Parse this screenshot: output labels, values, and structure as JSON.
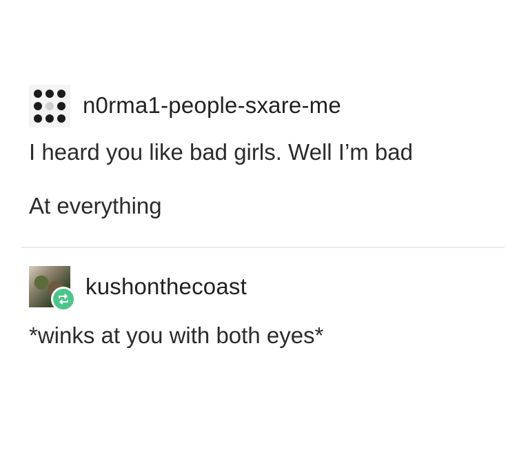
{
  "posts": [
    {
      "username": "n0rma1-people-sxare-me",
      "avatar_icon": "dot-grid-avatar-icon",
      "lines": [
        "I heard you like bad girls. Well I’m bad",
        "At everything"
      ]
    },
    {
      "username": "kushonthecoast",
      "avatar_icon": "photo-avatar-icon",
      "badge_icon": "reblog-icon",
      "badge_color": "#4cc58a",
      "lines": [
        "*winks at you with both eyes*"
      ]
    }
  ]
}
